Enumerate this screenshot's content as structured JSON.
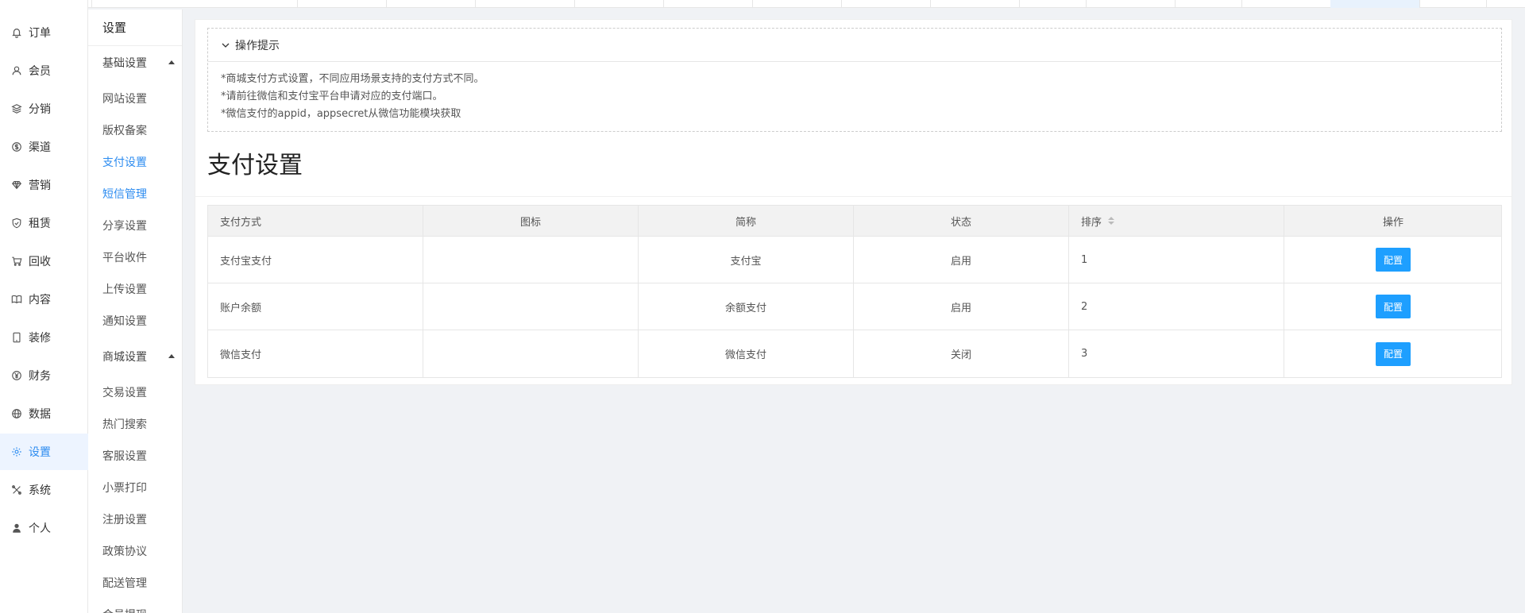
{
  "nav": {
    "items": [
      {
        "label": "订单",
        "icon": "bell-icon"
      },
      {
        "label": "会员",
        "icon": "user-icon"
      },
      {
        "label": "分销",
        "icon": "layers-icon"
      },
      {
        "label": "渠道",
        "icon": "dollar-circle-icon"
      },
      {
        "label": "营销",
        "icon": "diamond-icon"
      },
      {
        "label": "租赁",
        "icon": "shield-check-icon"
      },
      {
        "label": "回收",
        "icon": "cart-icon"
      },
      {
        "label": "内容",
        "icon": "book-icon"
      },
      {
        "label": "装修",
        "icon": "tablet-icon"
      },
      {
        "label": "财务",
        "icon": "yen-circle-icon"
      },
      {
        "label": "数据",
        "icon": "globe-icon"
      },
      {
        "label": "设置",
        "icon": "gear-icon"
      },
      {
        "label": "系统",
        "icon": "tools-icon"
      },
      {
        "label": "个人",
        "icon": "person-icon"
      }
    ]
  },
  "subnav": {
    "title": "设置",
    "groups": [
      {
        "label": "基础设置",
        "expanded": true,
        "items": [
          "网站设置",
          "版权备案",
          "支付设置",
          "短信管理",
          "分享设置",
          "平台收件",
          "上传设置",
          "通知设置"
        ]
      },
      {
        "label": "商城设置",
        "expanded": true,
        "items": [
          "交易设置",
          "热门搜索",
          "客服设置",
          "小票打印",
          "注册设置",
          "政策协议",
          "配送管理",
          "会员提现"
        ]
      }
    ],
    "active": "支付设置",
    "hover": "短信管理"
  },
  "tips": {
    "title": "操作提示",
    "lines": [
      "*商城支付方式设置，不同应用场景支持的支付方式不同。",
      "*请前往微信和支付宝平台申请对应的支付端口。",
      "*微信支付的appid，appsecret从微信功能模块获取"
    ]
  },
  "page": {
    "heading": "支付设置"
  },
  "table": {
    "headers": [
      "支付方式",
      "图标",
      "简称",
      "状态",
      "排序",
      "操作"
    ],
    "rows": [
      {
        "method": "支付宝支付",
        "icon": "",
        "short": "支付宝",
        "status": "启用",
        "order": "1",
        "action": "配置"
      },
      {
        "method": "账户余额",
        "icon": "",
        "short": "余额支付",
        "status": "启用",
        "order": "2",
        "action": "配置"
      },
      {
        "method": "微信支付",
        "icon": "",
        "short": "微信支付",
        "status": "关闭",
        "order": "3",
        "action": "配置"
      }
    ]
  },
  "colors": {
    "accent": "#2d8cf0",
    "button": "#1e9fff"
  }
}
